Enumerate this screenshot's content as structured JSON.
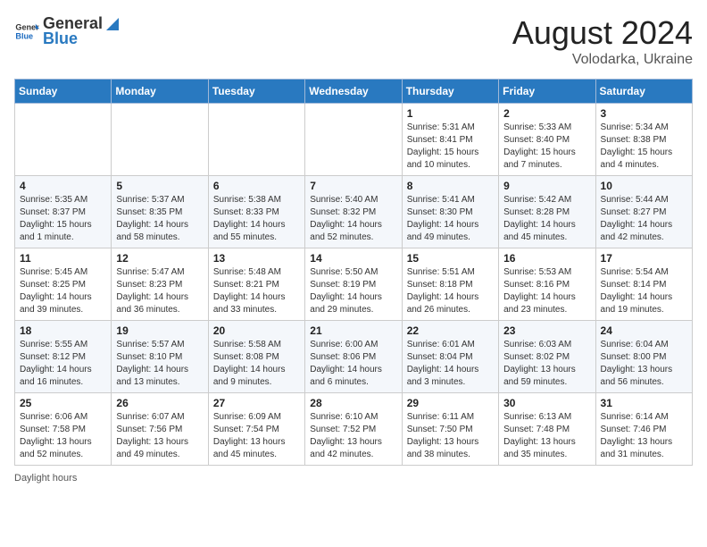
{
  "header": {
    "logo_general": "General",
    "logo_blue": "Blue",
    "month_year": "August 2024",
    "location": "Volodarka, Ukraine"
  },
  "footer": {
    "label": "Daylight hours"
  },
  "weekdays": [
    "Sunday",
    "Monday",
    "Tuesday",
    "Wednesday",
    "Thursday",
    "Friday",
    "Saturday"
  ],
  "weeks": [
    [
      {
        "day": "",
        "info": ""
      },
      {
        "day": "",
        "info": ""
      },
      {
        "day": "",
        "info": ""
      },
      {
        "day": "",
        "info": ""
      },
      {
        "day": "1",
        "info": "Sunrise: 5:31 AM\nSunset: 8:41 PM\nDaylight: 15 hours\nand 10 minutes."
      },
      {
        "day": "2",
        "info": "Sunrise: 5:33 AM\nSunset: 8:40 PM\nDaylight: 15 hours\nand 7 minutes."
      },
      {
        "day": "3",
        "info": "Sunrise: 5:34 AM\nSunset: 8:38 PM\nDaylight: 15 hours\nand 4 minutes."
      }
    ],
    [
      {
        "day": "4",
        "info": "Sunrise: 5:35 AM\nSunset: 8:37 PM\nDaylight: 15 hours\nand 1 minute."
      },
      {
        "day": "5",
        "info": "Sunrise: 5:37 AM\nSunset: 8:35 PM\nDaylight: 14 hours\nand 58 minutes."
      },
      {
        "day": "6",
        "info": "Sunrise: 5:38 AM\nSunset: 8:33 PM\nDaylight: 14 hours\nand 55 minutes."
      },
      {
        "day": "7",
        "info": "Sunrise: 5:40 AM\nSunset: 8:32 PM\nDaylight: 14 hours\nand 52 minutes."
      },
      {
        "day": "8",
        "info": "Sunrise: 5:41 AM\nSunset: 8:30 PM\nDaylight: 14 hours\nand 49 minutes."
      },
      {
        "day": "9",
        "info": "Sunrise: 5:42 AM\nSunset: 8:28 PM\nDaylight: 14 hours\nand 45 minutes."
      },
      {
        "day": "10",
        "info": "Sunrise: 5:44 AM\nSunset: 8:27 PM\nDaylight: 14 hours\nand 42 minutes."
      }
    ],
    [
      {
        "day": "11",
        "info": "Sunrise: 5:45 AM\nSunset: 8:25 PM\nDaylight: 14 hours\nand 39 minutes."
      },
      {
        "day": "12",
        "info": "Sunrise: 5:47 AM\nSunset: 8:23 PM\nDaylight: 14 hours\nand 36 minutes."
      },
      {
        "day": "13",
        "info": "Sunrise: 5:48 AM\nSunset: 8:21 PM\nDaylight: 14 hours\nand 33 minutes."
      },
      {
        "day": "14",
        "info": "Sunrise: 5:50 AM\nSunset: 8:19 PM\nDaylight: 14 hours\nand 29 minutes."
      },
      {
        "day": "15",
        "info": "Sunrise: 5:51 AM\nSunset: 8:18 PM\nDaylight: 14 hours\nand 26 minutes."
      },
      {
        "day": "16",
        "info": "Sunrise: 5:53 AM\nSunset: 8:16 PM\nDaylight: 14 hours\nand 23 minutes."
      },
      {
        "day": "17",
        "info": "Sunrise: 5:54 AM\nSunset: 8:14 PM\nDaylight: 14 hours\nand 19 minutes."
      }
    ],
    [
      {
        "day": "18",
        "info": "Sunrise: 5:55 AM\nSunset: 8:12 PM\nDaylight: 14 hours\nand 16 minutes."
      },
      {
        "day": "19",
        "info": "Sunrise: 5:57 AM\nSunset: 8:10 PM\nDaylight: 14 hours\nand 13 minutes."
      },
      {
        "day": "20",
        "info": "Sunrise: 5:58 AM\nSunset: 8:08 PM\nDaylight: 14 hours\nand 9 minutes."
      },
      {
        "day": "21",
        "info": "Sunrise: 6:00 AM\nSunset: 8:06 PM\nDaylight: 14 hours\nand 6 minutes."
      },
      {
        "day": "22",
        "info": "Sunrise: 6:01 AM\nSunset: 8:04 PM\nDaylight: 14 hours\nand 3 minutes."
      },
      {
        "day": "23",
        "info": "Sunrise: 6:03 AM\nSunset: 8:02 PM\nDaylight: 13 hours\nand 59 minutes."
      },
      {
        "day": "24",
        "info": "Sunrise: 6:04 AM\nSunset: 8:00 PM\nDaylight: 13 hours\nand 56 minutes."
      }
    ],
    [
      {
        "day": "25",
        "info": "Sunrise: 6:06 AM\nSunset: 7:58 PM\nDaylight: 13 hours\nand 52 minutes."
      },
      {
        "day": "26",
        "info": "Sunrise: 6:07 AM\nSunset: 7:56 PM\nDaylight: 13 hours\nand 49 minutes."
      },
      {
        "day": "27",
        "info": "Sunrise: 6:09 AM\nSunset: 7:54 PM\nDaylight: 13 hours\nand 45 minutes."
      },
      {
        "day": "28",
        "info": "Sunrise: 6:10 AM\nSunset: 7:52 PM\nDaylight: 13 hours\nand 42 minutes."
      },
      {
        "day": "29",
        "info": "Sunrise: 6:11 AM\nSunset: 7:50 PM\nDaylight: 13 hours\nand 38 minutes."
      },
      {
        "day": "30",
        "info": "Sunrise: 6:13 AM\nSunset: 7:48 PM\nDaylight: 13 hours\nand 35 minutes."
      },
      {
        "day": "31",
        "info": "Sunrise: 6:14 AM\nSunset: 7:46 PM\nDaylight: 13 hours\nand 31 minutes."
      }
    ]
  ]
}
